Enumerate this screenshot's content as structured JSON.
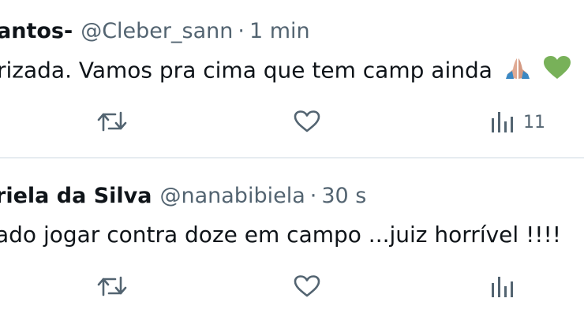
{
  "tweets": [
    {
      "display_name": "antos-",
      "handle": "@Cleber_sann",
      "separator": "·",
      "time": "1 min",
      "text": "rizada. Vamos pra cima que tem camp ainda",
      "emojis": [
        "folded-hands-icon",
        "green-heart-icon"
      ],
      "views": "11"
    },
    {
      "display_name": "riela da Silva",
      "handle": "@nanabibiela",
      "separator": "·",
      "time": "30 s",
      "text": "ado jogar contra doze em campo ...juiz horrível !!!!",
      "emojis": [],
      "views": ""
    }
  ],
  "colors": {
    "text": "#0f1419",
    "secondary": "#536471",
    "divider": "#e6ecf0",
    "green_heart": "#78b159",
    "hands": "#e0aa94"
  }
}
